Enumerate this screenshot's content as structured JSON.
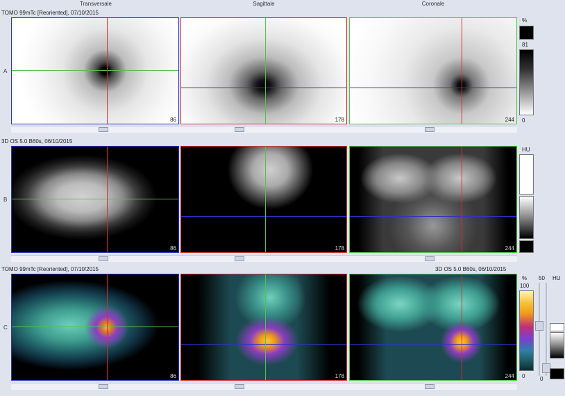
{
  "columns": [
    "Transversale",
    "Sagittale",
    "Coronale"
  ],
  "rows": {
    "A": {
      "letter": "A",
      "title": "TOMO 99mTc [Reoriented], 07/10/2015",
      "nums": [
        "86",
        "178",
        "244"
      ]
    },
    "B": {
      "letter": "B",
      "title": "3D OS 5.0 B60s, 06/10/2015",
      "nums": [
        "86",
        "178",
        "244"
      ]
    },
    "C": {
      "letter": "C",
      "title_left": "TOMO 99mTc [Reoriented], 07/10/2015",
      "title_right": "3D OS 5.0 B60s, 06/10/2015",
      "nums": [
        "86",
        "178",
        "244"
      ]
    }
  },
  "scales": {
    "a_unit": "%",
    "a_top": "81",
    "a_bottom": "0",
    "b_unit": "HU",
    "c_unit": "%",
    "c_top": "100",
    "c_bottom": "0",
    "c_mid": "50",
    "c_mid_bottom": "0",
    "c_hu": "HU"
  },
  "colors": {
    "red": "#d32f2f",
    "green": "#52c34a",
    "blue": "#2a34c8",
    "accent_orange": "#f29b16"
  }
}
